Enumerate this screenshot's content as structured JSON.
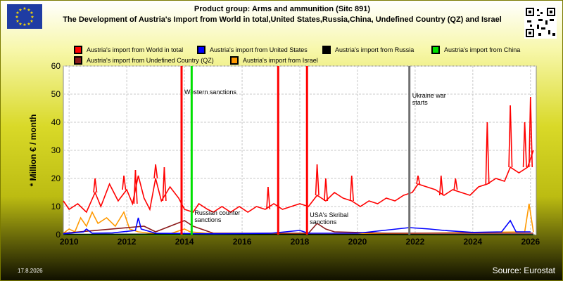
{
  "header": {
    "title_line1": "Product group: Arms and ammunition (Sitc 891)",
    "title_line2": "The Development of Austria's Import from World in total,United States,Russia,China, Undefined Country (QZ) and Israel",
    "flag_icon": "eu-flag-icon",
    "qr_icon": "qr-code-icon"
  },
  "footer": {
    "date": "17.8.2026",
    "source": "Source: Eurostat"
  },
  "chart_data": {
    "type": "line",
    "ylabel": "* Million € / month",
    "xlabel": "",
    "xlim": [
      2009.8,
      2026.2
    ],
    "ylim": [
      0,
      60
    ],
    "grid": true,
    "legend_position": "top",
    "x_ticks": [
      "2010",
      "2012",
      "2014",
      "2016",
      "2018",
      "2020",
      "2022",
      "2024",
      "2026"
    ],
    "y_ticks": [
      "0",
      "10",
      "20",
      "30",
      "40",
      "50",
      "60"
    ],
    "series": [
      {
        "name": "Austria's import from World in total",
        "color": "#ff0000",
        "points": [
          [
            2009.8,
            12
          ],
          [
            2010.0,
            9
          ],
          [
            2010.3,
            11
          ],
          [
            2010.6,
            8
          ],
          [
            2010.9,
            15
          ],
          [
            2011.1,
            10
          ],
          [
            2011.4,
            18
          ],
          [
            2011.7,
            12
          ],
          [
            2012.0,
            16
          ],
          [
            2012.2,
            11
          ],
          [
            2012.4,
            21
          ],
          [
            2012.6,
            13
          ],
          [
            2012.8,
            9
          ],
          [
            2013.0,
            20
          ],
          [
            2013.2,
            12
          ],
          [
            2013.5,
            17
          ],
          [
            2013.8,
            13
          ],
          [
            2014.0,
            9
          ],
          [
            2014.3,
            8
          ],
          [
            2014.5,
            11
          ],
          [
            2014.8,
            9
          ],
          [
            2015.0,
            8
          ],
          [
            2015.3,
            10
          ],
          [
            2015.6,
            8
          ],
          [
            2015.9,
            10
          ],
          [
            2016.2,
            8
          ],
          [
            2016.5,
            10
          ],
          [
            2016.8,
            9
          ],
          [
            2017.1,
            11
          ],
          [
            2017.4,
            9
          ],
          [
            2017.7,
            10
          ],
          [
            2018.0,
            11
          ],
          [
            2018.3,
            10
          ],
          [
            2018.6,
            14
          ],
          [
            2018.9,
            12
          ],
          [
            2019.2,
            15
          ],
          [
            2019.5,
            13
          ],
          [
            2019.8,
            12
          ],
          [
            2020.1,
            10
          ],
          [
            2020.4,
            12
          ],
          [
            2020.7,
            11
          ],
          [
            2021.0,
            13
          ],
          [
            2021.3,
            12
          ],
          [
            2021.6,
            14
          ],
          [
            2021.9,
            15
          ],
          [
            2022.1,
            18
          ],
          [
            2022.4,
            17
          ],
          [
            2022.7,
            16
          ],
          [
            2023.0,
            14
          ],
          [
            2023.3,
            16
          ],
          [
            2023.6,
            15
          ],
          [
            2023.9,
            14
          ],
          [
            2024.2,
            17
          ],
          [
            2024.5,
            18
          ],
          [
            2024.8,
            20
          ],
          [
            2025.1,
            19
          ],
          [
            2025.3,
            24
          ],
          [
            2025.6,
            22
          ],
          [
            2025.9,
            24
          ],
          [
            2026.1,
            30
          ]
        ],
        "spikes": [
          [
            2010.9,
            20
          ],
          [
            2011.9,
            21
          ],
          [
            2012.3,
            23
          ],
          [
            2013.0,
            25
          ],
          [
            2013.3,
            24
          ],
          [
            2016.9,
            17
          ],
          [
            2018.6,
            25
          ],
          [
            2018.9,
            20
          ],
          [
            2019.8,
            21
          ],
          [
            2022.1,
            21
          ],
          [
            2022.9,
            21
          ],
          [
            2023.4,
            20
          ],
          [
            2024.5,
            40
          ],
          [
            2025.3,
            46
          ],
          [
            2025.8,
            40
          ],
          [
            2026.0,
            49
          ]
        ]
      },
      {
        "name": "Austria's import from United States",
        "color": "#0000ff",
        "points": [
          [
            2009.8,
            0.3
          ],
          [
            2010.5,
            1
          ],
          [
            2010.6,
            2
          ],
          [
            2010.8,
            0.5
          ],
          [
            2011.5,
            0.6
          ],
          [
            2012.3,
            1.5
          ],
          [
            2012.4,
            6
          ],
          [
            2012.5,
            2
          ],
          [
            2013.0,
            0.5
          ],
          [
            2015.0,
            0.3
          ],
          [
            2017.0,
            0.5
          ],
          [
            2018.0,
            1.5
          ],
          [
            2018.3,
            0.5
          ],
          [
            2020.0,
            0.5
          ],
          [
            2021.8,
            2.5
          ],
          [
            2022.5,
            2
          ],
          [
            2023.0,
            1.5
          ],
          [
            2024.0,
            0.8
          ],
          [
            2025.0,
            1
          ],
          [
            2025.3,
            5
          ],
          [
            2025.5,
            1
          ],
          [
            2026.0,
            1
          ]
        ]
      },
      {
        "name": "Austria's import from Russia",
        "color": "#000000",
        "points": [
          [
            2009.8,
            0.1
          ],
          [
            2014.0,
            0.2
          ],
          [
            2014.5,
            0.1
          ],
          [
            2026.1,
            0
          ]
        ]
      },
      {
        "name": "Austria's import from China",
        "color": "#00e000",
        "points": [
          [
            2009.8,
            0
          ],
          [
            2026.1,
            0
          ]
        ]
      },
      {
        "name": "Austria's import from Undefined Country (QZ)",
        "color": "#8b1a1a",
        "points": [
          [
            2009.8,
            0.5
          ],
          [
            2012.6,
            3
          ],
          [
            2013.0,
            1
          ],
          [
            2014.0,
            5
          ],
          [
            2014.3,
            3
          ],
          [
            2015.0,
            0.5
          ],
          [
            2018.3,
            0.5
          ],
          [
            2018.6,
            4
          ],
          [
            2018.9,
            2
          ],
          [
            2019.2,
            1
          ],
          [
            2021.0,
            0.5
          ],
          [
            2026.1,
            0.5
          ]
        ]
      },
      {
        "name": "Austria's import from Israel",
        "color": "#ff9900",
        "points": [
          [
            2009.8,
            0.5
          ],
          [
            2010.0,
            2
          ],
          [
            2010.2,
            1
          ],
          [
            2010.4,
            6
          ],
          [
            2010.6,
            3
          ],
          [
            2010.8,
            8
          ],
          [
            2011.0,
            4
          ],
          [
            2011.3,
            6
          ],
          [
            2011.6,
            3
          ],
          [
            2011.9,
            8
          ],
          [
            2012.1,
            2
          ],
          [
            2012.4,
            1
          ],
          [
            2012.8,
            0.5
          ],
          [
            2013.5,
            0.3
          ],
          [
            2014.0,
            2
          ],
          [
            2014.2,
            1
          ],
          [
            2015.0,
            0.3
          ],
          [
            2018.0,
            0.3
          ],
          [
            2022.0,
            0.5
          ],
          [
            2025.8,
            1
          ],
          [
            2025.95,
            11
          ],
          [
            2026.1,
            1
          ]
        ]
      }
    ],
    "events": [
      {
        "label": "Western sanctions",
        "x": 2013.9,
        "color": "#ff0000"
      },
      {
        "label": "Russian counter sanctions",
        "x": 2014.25,
        "color": "#00e000"
      },
      {
        "label": "",
        "x": 2017.25,
        "color": "#ff0000"
      },
      {
        "label": "USA's Skribal sanctions",
        "x": 2018.25,
        "color": "#ff0000"
      },
      {
        "label": "Ukraine war starts",
        "x": 2021.8,
        "color": "#707070"
      }
    ]
  }
}
